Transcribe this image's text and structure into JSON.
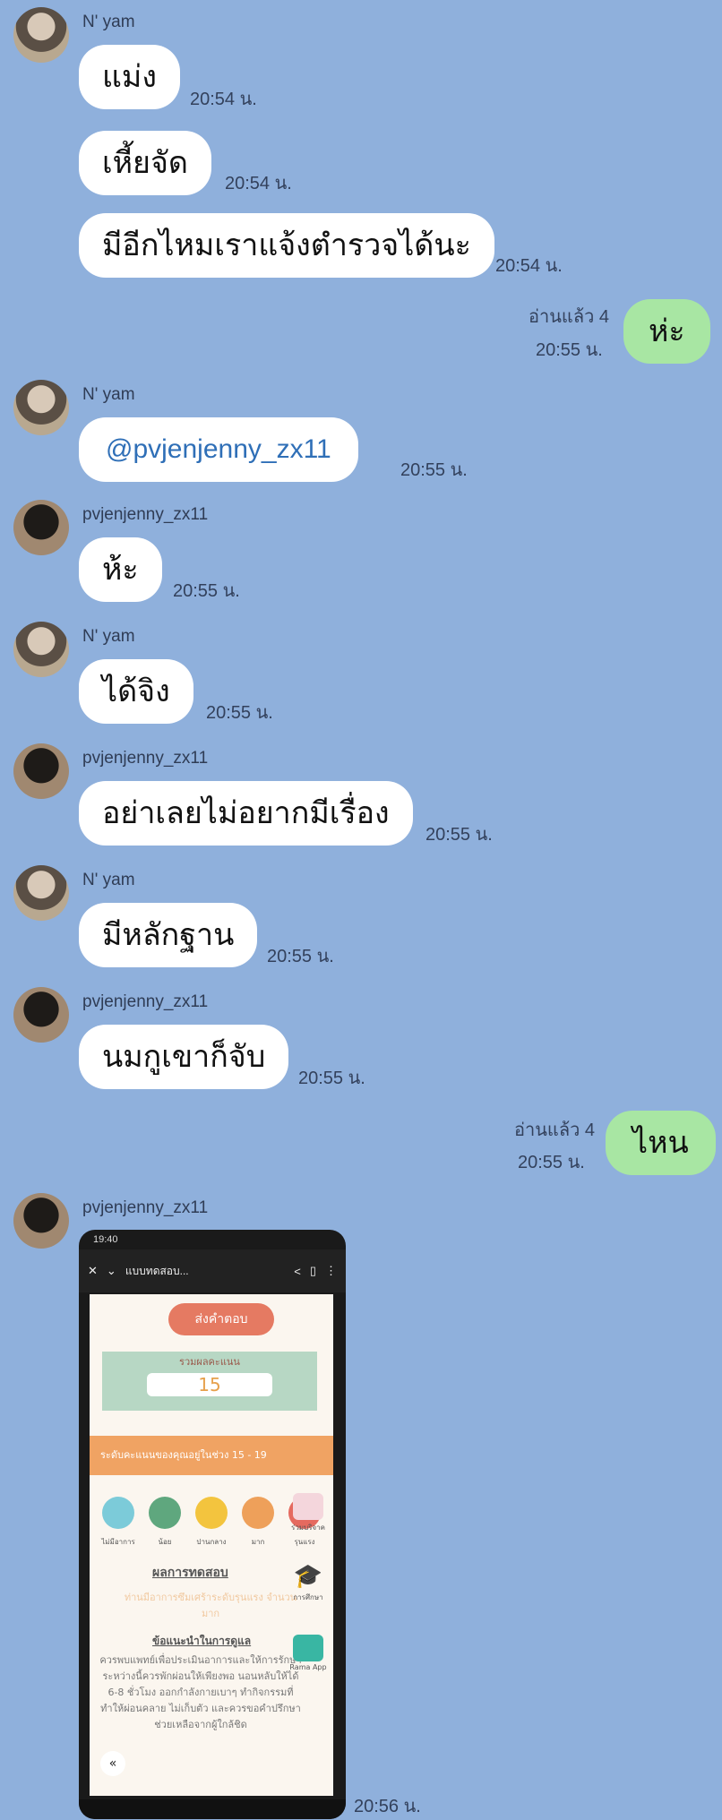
{
  "messages": [
    {
      "sender": "N' yam",
      "text": "แม่ง",
      "time": "20:54 น."
    },
    {
      "text": "เหี้ยจัด",
      "time": "20:54 น."
    },
    {
      "text": "มีอีกไหมเราแจ้งตำรวจได้นะ",
      "time": "20:54 น."
    },
    {
      "me": true,
      "read": "อ่านแล้ว 4",
      "text": "ห่ะ",
      "time": "20:55 น."
    },
    {
      "sender": "N' yam",
      "text": "@pvjenjenny_zx11",
      "time": "20:55 น."
    },
    {
      "sender": "pvjenjenny_zx11",
      "text": "ห้ะ",
      "time": "20:55 น."
    },
    {
      "sender": "N' yam",
      "text": "ได้จิง",
      "time": "20:55 น."
    },
    {
      "sender": "pvjenjenny_zx11",
      "text": "อย่าเลยไม่อยากมีเรื่อง",
      "time": "20:55 น."
    },
    {
      "sender": "N' yam",
      "text": "มีหลักฐาน",
      "time": "20:55 น."
    },
    {
      "sender": "pvjenjenny_zx11",
      "text": "นมกูเขาก็จับ",
      "time": "20:55 น."
    },
    {
      "me": true,
      "read": "อ่านแล้ว 4",
      "text": "ไหน",
      "time": "20:55 น."
    },
    {
      "sender": "pvjenjenny_zx11",
      "image": true,
      "time": "20:56 น."
    }
  ],
  "screenshot": {
    "status_time": "19:40",
    "page_title": "แบบทดสอบ...",
    "submit_label": "ส่งคำตอบ",
    "score_label": "รวมผลคะแนน",
    "score_value": "15",
    "range_text": "ระดับคะแนนของคุณอยู่ในช่วง 15 - 19",
    "levels": [
      "ไม่มีอาการ",
      "น้อย",
      "ปานกลาง",
      "มาก",
      "รุนแรง"
    ],
    "level_colors": [
      "#7ccbd9",
      "#5fa77e",
      "#f3c43e",
      "#eea05a",
      "#e56a5f"
    ],
    "result_heading": "ผลการทดสอบ",
    "result_text": "ท่านมีอาการซึมเศร้าระดับรุนแรง จำนวนมาก",
    "advice_heading": "ข้อแนะนำในการดูแล",
    "advice_text": "ควรพบแพทย์เพื่อประเมินอาการและให้การรักษา ระหว่างนี้ควรพักผ่อนให้เพียงพอ นอนหลับให้ได้ 6-8 ชั่วโมง ออกกำลังกายเบาๆ ทำกิจกรรมที่ทำให้ผ่อนคลาย ไม่เก็บตัว และควรขอคำปรึกษาช่วยเหลือจากผู้ใกล้ชิด",
    "side_items": [
      "ร่วมบริจาค",
      "การศึกษา",
      "Rama App"
    ]
  }
}
